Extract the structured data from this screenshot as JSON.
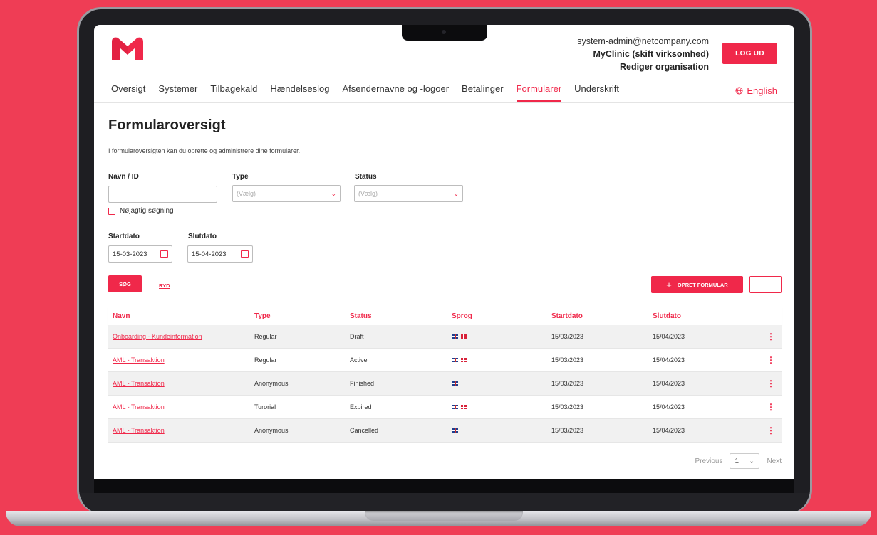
{
  "header": {
    "email": "system-admin@netcompany.com",
    "org": "MyClinic (skift virksomhed)",
    "edit_org": "Rediger organisation",
    "logout_label": "LOG UD",
    "logo_color": "#f0284a"
  },
  "nav": {
    "tabs": [
      {
        "label": "Oversigt"
      },
      {
        "label": "Systemer"
      },
      {
        "label": "Tilbagekald"
      },
      {
        "label": "Hændelseslog"
      },
      {
        "label": "Afsendernavne og -logoer"
      },
      {
        "label": "Betalinger"
      },
      {
        "label": "Formularer",
        "active": true
      },
      {
        "label": "Underskrift"
      }
    ],
    "language": "English"
  },
  "page": {
    "title": "Formularoversigt",
    "description": "I formularoversigten kan du oprette og administrere dine formularer."
  },
  "filters": {
    "name_label": "Navn  / ID",
    "name_value": "",
    "type_label": "Type",
    "type_placeholder": "(Vælg)",
    "status_label": "Status",
    "status_placeholder": "(Vælg)",
    "exact_search_label": "Nøjagtig søgning",
    "start_label": "Startdato",
    "start_value": "15-03-2023",
    "end_label": "Slutdato",
    "end_value": "15-04-2023"
  },
  "actions": {
    "search_label": "SØG",
    "clear_label": "RYD",
    "create_label": "OPRET FORMULAR",
    "more_label": "···"
  },
  "table": {
    "headers": {
      "name": "Navn",
      "type": "Type",
      "status": "Status",
      "language": "Sprog",
      "start": "Startdato",
      "end": "Slutdato"
    },
    "rows": [
      {
        "name": "Onboarding - Kundeinformation",
        "type": "Regular",
        "status": "Draft",
        "languages": [
          "uk",
          "dk"
        ],
        "start": "15/03/2023",
        "end": "15/04/2023"
      },
      {
        "name": "AML - Transaktion",
        "type": "Regular",
        "status": "Active",
        "languages": [
          "uk",
          "dk"
        ],
        "start": "15/03/2023",
        "end": "15/04/2023"
      },
      {
        "name": "AML - Transaktion",
        "type": "Anonymous",
        "status": "Finished",
        "languages": [
          "uk"
        ],
        "start": "15/03/2023",
        "end": "15/04/2023"
      },
      {
        "name": "AML - Transaktion",
        "type": "Turorial",
        "status": "Expired",
        "languages": [
          "uk",
          "dk"
        ],
        "start": "15/03/2023",
        "end": "15/04/2023"
      },
      {
        "name": "AML - Transaktion",
        "type": "Anonymous",
        "status": "Cancelled",
        "languages": [
          "uk"
        ],
        "start": "15/03/2023",
        "end": "15/04/2023"
      }
    ]
  },
  "pagination": {
    "previous": "Previous",
    "page": "1",
    "next": "Next"
  }
}
